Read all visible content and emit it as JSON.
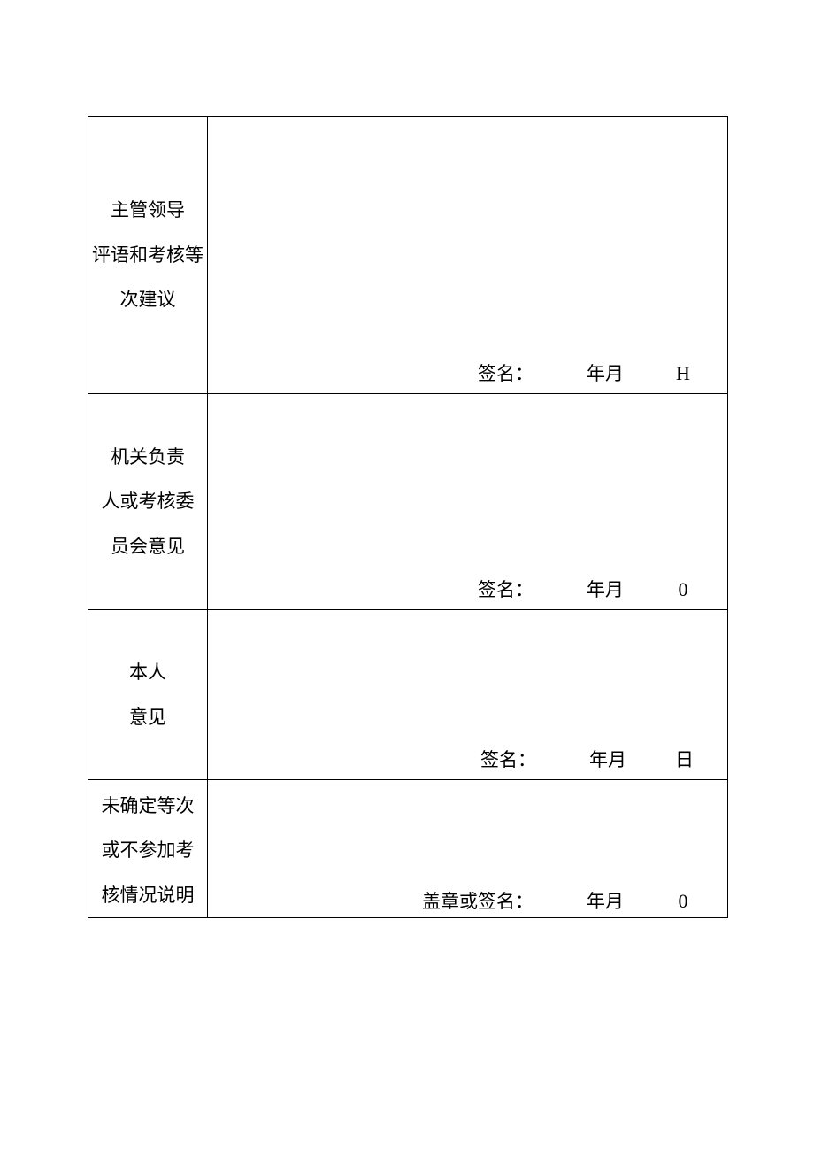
{
  "rows": [
    {
      "label_lines": [
        "主管领导",
        "评语和考核等",
        "次建议"
      ],
      "sig_label": "签名：",
      "ym": "年月",
      "day": "H",
      "day_class": "day"
    },
    {
      "label_lines": [
        "机关负责",
        "人或考核委",
        "员会意见"
      ],
      "sig_label": "签名：",
      "ym": "年月",
      "day": "0",
      "day_class": "day"
    },
    {
      "label_lines": [
        "本人",
        "意见"
      ],
      "sig_label": "签名：",
      "ym": "年月",
      "day": "日",
      "day_class": "day-cn"
    },
    {
      "label_lines": [
        "未确定等次",
        "或不参加考",
        "核情况说明"
      ],
      "sig_label": "盖章或签名：",
      "ym": "年月",
      "day": "0",
      "day_class": "day"
    }
  ]
}
